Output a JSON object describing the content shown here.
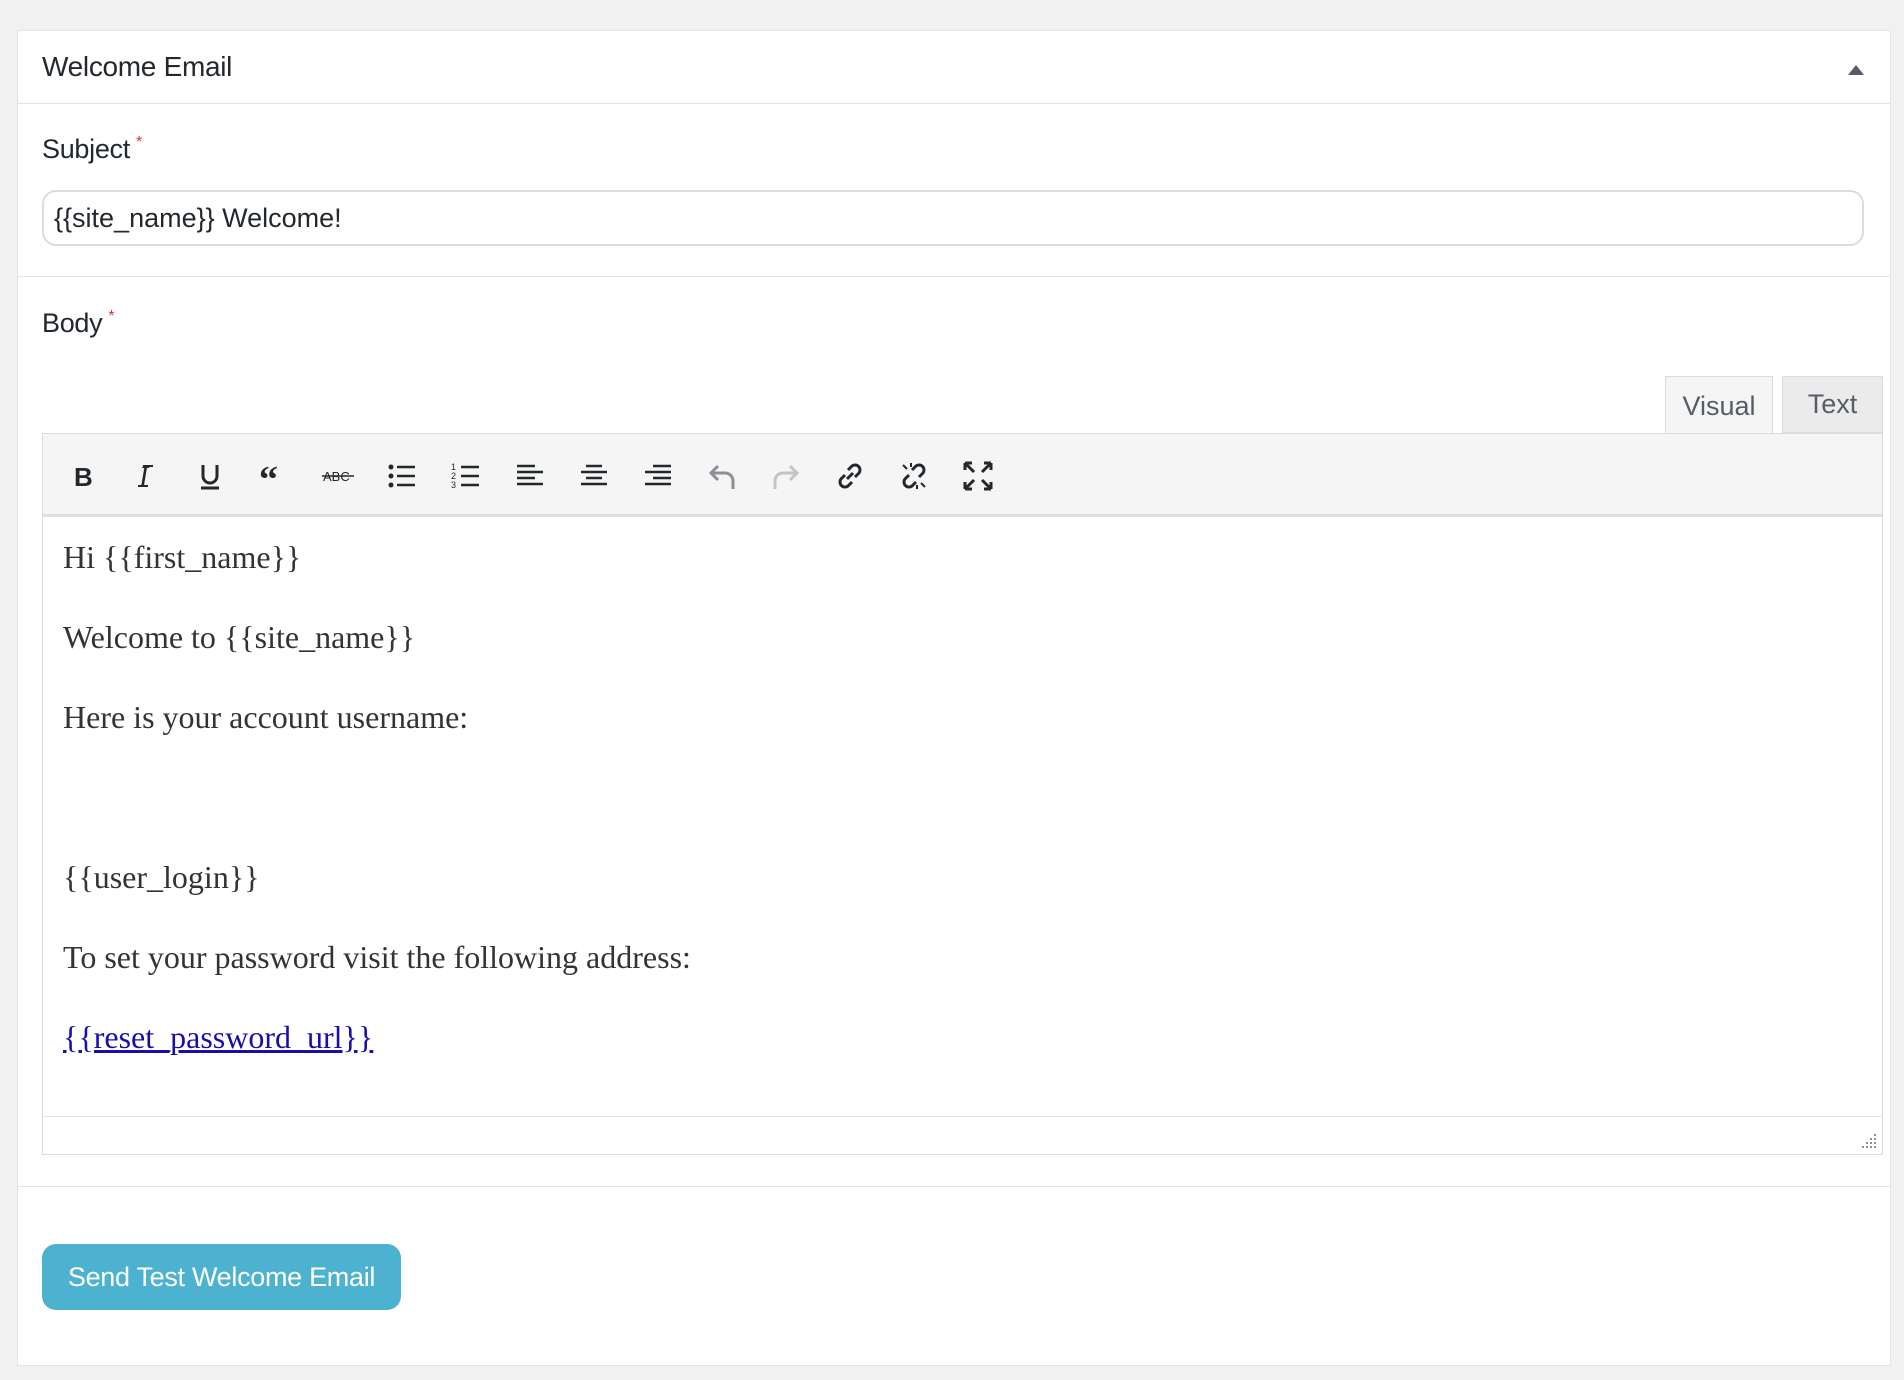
{
  "panel": {
    "title": "Welcome Email"
  },
  "subject": {
    "label": "Subject",
    "required_mark": "*",
    "value": "{{site_name}} Welcome!"
  },
  "body": {
    "label": "Body",
    "required_mark": "*"
  },
  "editor": {
    "tabs": [
      {
        "label": "Visual",
        "active": true
      },
      {
        "label": "Text",
        "active": false
      }
    ],
    "toolbar": [
      "bold-icon",
      "italic-icon",
      "underline-icon",
      "blockquote-icon",
      "strikethrough-icon",
      "bulleted-list-icon",
      "numbered-list-icon",
      "align-left-icon",
      "align-center-icon",
      "align-right-icon",
      "undo-icon",
      "redo-icon",
      "link-icon",
      "unlink-icon",
      "fullscreen-icon"
    ],
    "content": {
      "line1": "Hi {{first_name}}",
      "line2": "Welcome to {{site_name}}",
      "line3": "Here is your account username:",
      "line4": "{{user_login}}",
      "line5": "To set your password visit the following address:",
      "link": "{{reset_password_url}}"
    }
  },
  "actions": {
    "send_test": "Send Test Welcome Email"
  },
  "colors": {
    "accent": "#4db2cf",
    "link": "#1a0dab",
    "required": "#dc3232"
  }
}
